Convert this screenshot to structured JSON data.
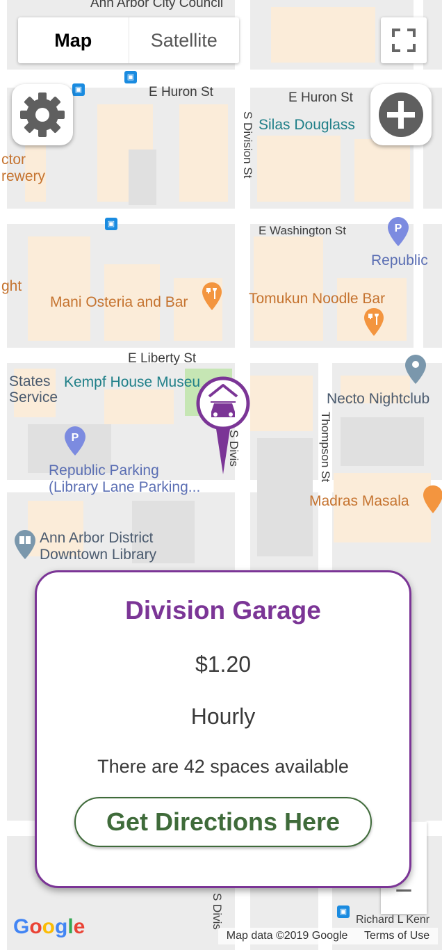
{
  "map": {
    "streets": {
      "huron_1": "E Huron St",
      "huron_2": "E Huron St",
      "washington": "E Washington St",
      "liberty": "E Liberty St",
      "division_1": "S Division St",
      "division_2": "S Divis",
      "division_3": "S Divis",
      "thompson": "Thompson St",
      "ann_arbor_city_council": "Ann Arbor City Council",
      "richard": "Richard L Kenr"
    },
    "pois": {
      "silas": "Silas Douglass",
      "brewery_1": "ctor",
      "brewery_2": "rewery",
      "republic": "Republic",
      "ght": "ght",
      "mani": "Mani Osteria and Bar",
      "tomukun": "Tomukun Noodle Bar",
      "states_1": "States",
      "states_2": "Service",
      "kempf": "Kempf House Museu",
      "necto": "Necto Nightclub",
      "republic_parking_1": "Republic Parking",
      "republic_parking_2": "(Library Lane Parking...",
      "madras": "Madras Masala",
      "library_1": "Ann Arbor District",
      "library_2": "Downtown Library"
    },
    "parking_letter": "P"
  },
  "controls": {
    "map_type": [
      "Map",
      "Satellite"
    ],
    "zoom_in": "+",
    "zoom_out": "−"
  },
  "card": {
    "title": "Division Garage",
    "price": "$1.20",
    "rate": "Hourly",
    "spaces": "There are 42 spaces available",
    "button": "Get Directions Here"
  },
  "footer": {
    "logo": "Google",
    "map_data": "Map data ©2019 Google",
    "terms": "Terms of Use"
  },
  "colors": {
    "accent_purple": "#7b3596",
    "directions_green": "#3f6b3a"
  }
}
